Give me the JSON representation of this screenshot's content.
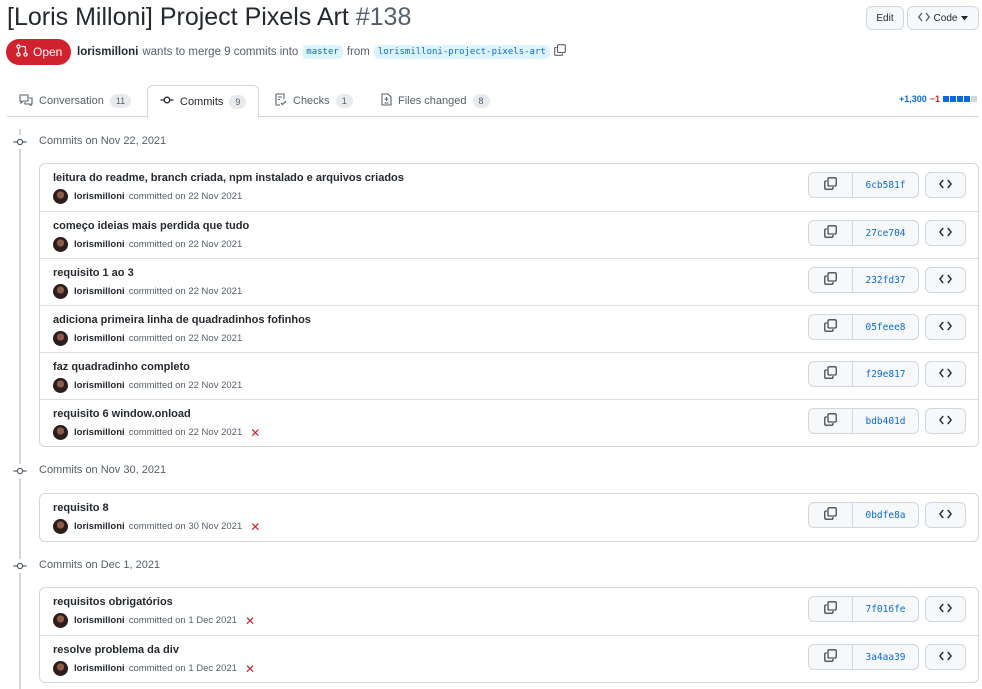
{
  "header": {
    "title": "[Loris Milloni] Project Pixels Art",
    "number": "#138",
    "edit_label": "Edit",
    "code_label": "Code"
  },
  "meta": {
    "state": "Open",
    "author": "lorismilloni",
    "text_merge": "wants to merge 9 commits into",
    "base_branch": "master",
    "text_from": "from",
    "head_branch": "lorismilloni-project-pixels-art"
  },
  "tabs": [
    {
      "label": "Conversation",
      "count": "11"
    },
    {
      "label": "Commits",
      "count": "9"
    },
    {
      "label": "Checks",
      "count": "1"
    },
    {
      "label": "Files changed",
      "count": "8"
    }
  ],
  "diffstat": {
    "additions": "+1,300",
    "deletions": "−1"
  },
  "colors": {
    "danger": "#cf222e",
    "accent": "#0969da",
    "border": "#d0d7de"
  },
  "groups": [
    {
      "date_label": "Commits on Nov 22, 2021",
      "commits": [
        {
          "message": "leitura do readme, branch criada, npm instalado e arquivos criados",
          "author": "lorismilloni",
          "committed": "committed on 22 Nov 2021",
          "sha": "6cb581f",
          "failed": false
        },
        {
          "message": "começo ideias mais perdida que tudo",
          "author": "lorismilloni",
          "committed": "committed on 22 Nov 2021",
          "sha": "27ce704",
          "failed": false
        },
        {
          "message": "requisito 1 ao 3",
          "author": "lorismilloni",
          "committed": "committed on 22 Nov 2021",
          "sha": "232fd37",
          "failed": false
        },
        {
          "message": "adiciona primeira linha de quadradinhos fofinhos",
          "author": "lorismilloni",
          "committed": "committed on 22 Nov 2021",
          "sha": "05feee8",
          "failed": false
        },
        {
          "message": "faz quadradinho completo",
          "author": "lorismilloni",
          "committed": "committed on 22 Nov 2021",
          "sha": "f29e817",
          "failed": false
        },
        {
          "message": "requisito 6 window.onload",
          "author": "lorismilloni",
          "committed": "committed on 22 Nov 2021",
          "sha": "bdb401d",
          "failed": true
        }
      ]
    },
    {
      "date_label": "Commits on Nov 30, 2021",
      "commits": [
        {
          "message": "requisito 8",
          "author": "lorismilloni",
          "committed": "committed on 30 Nov 2021",
          "sha": "0bdfe8a",
          "failed": true
        }
      ]
    },
    {
      "date_label": "Commits on Dec 1, 2021",
      "commits": [
        {
          "message": "requisitos obrigatórios",
          "author": "lorismilloni",
          "committed": "committed on 1 Dec 2021",
          "sha": "7f016fe",
          "failed": true
        },
        {
          "message": "resolve problema da div",
          "author": "lorismilloni",
          "committed": "committed on 1 Dec 2021",
          "sha": "3a4aa39",
          "failed": true
        }
      ]
    }
  ]
}
